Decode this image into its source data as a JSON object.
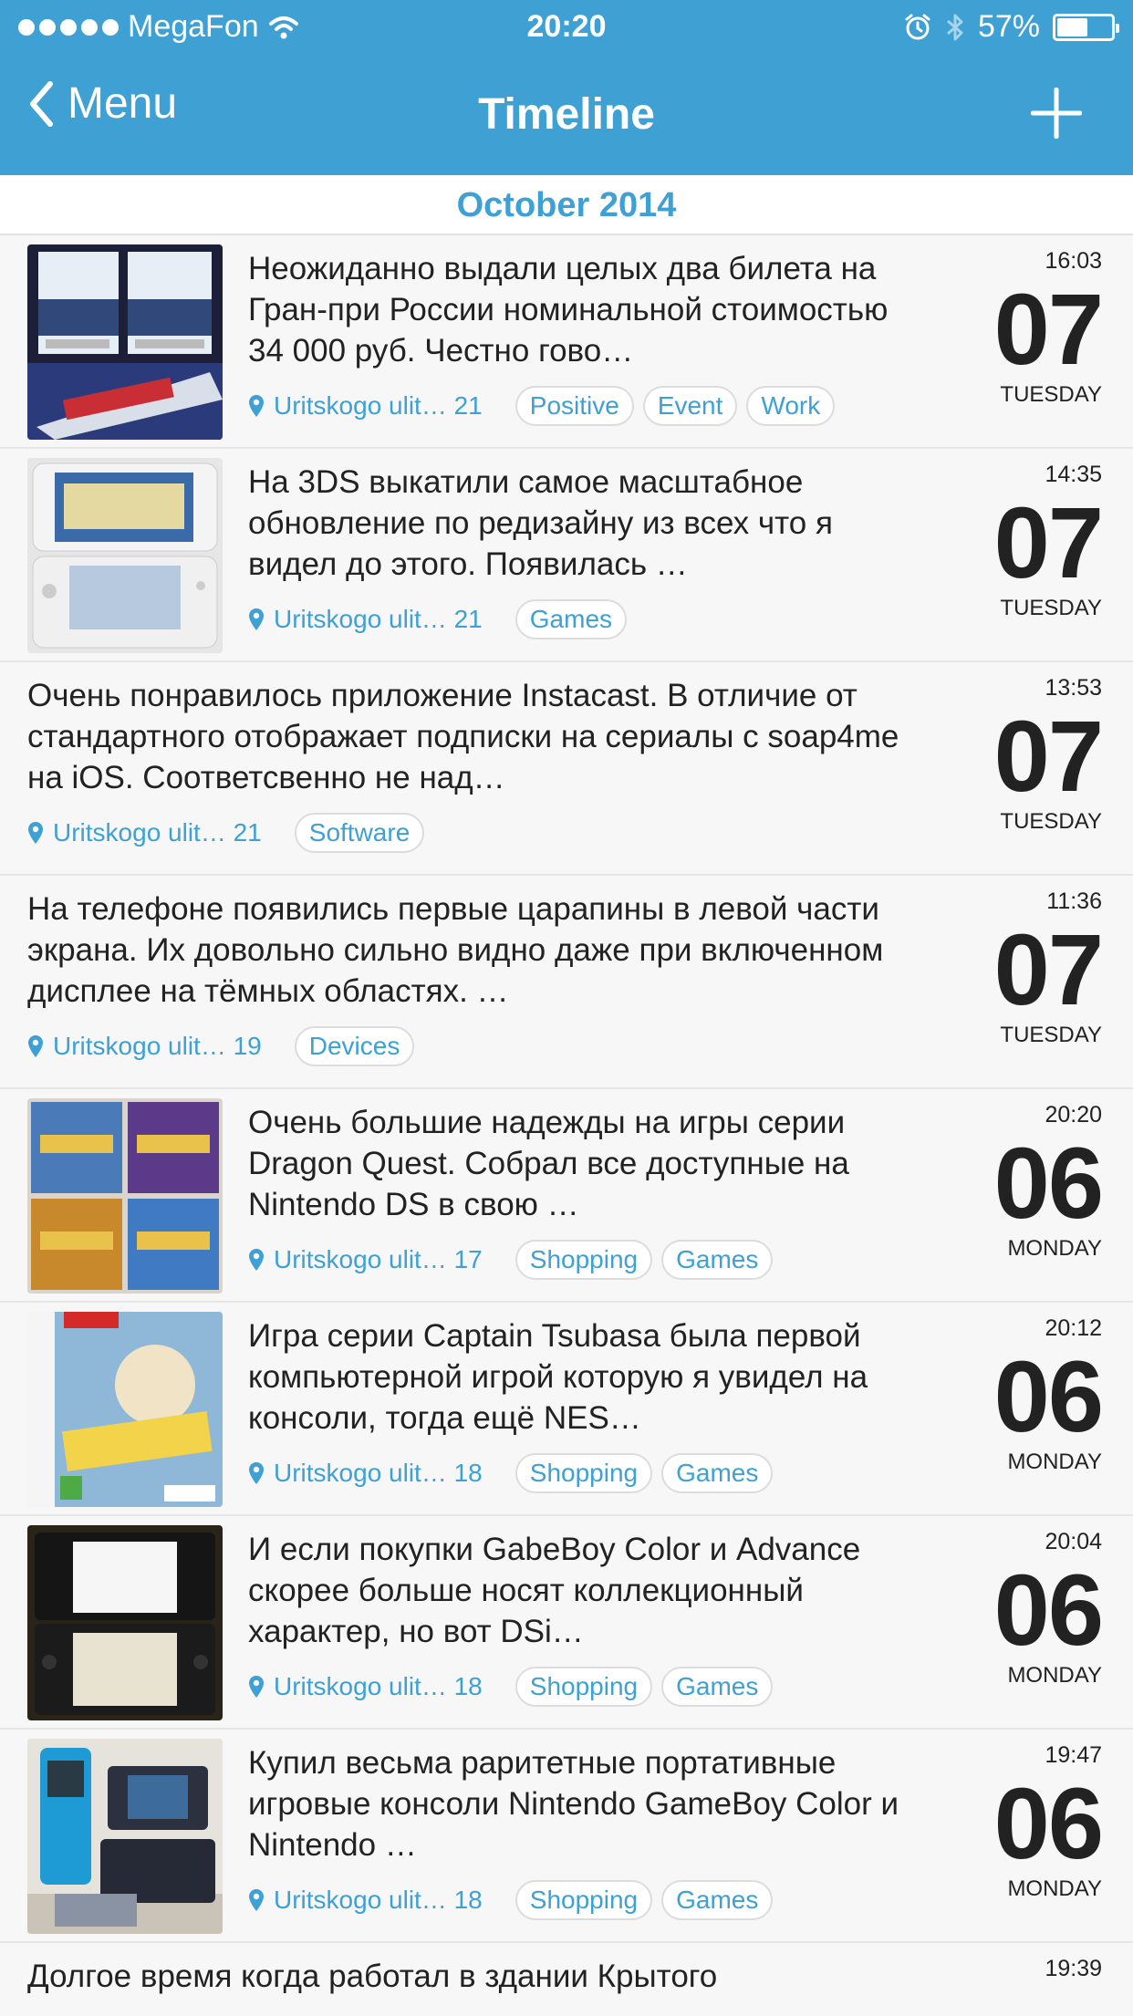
{
  "status": {
    "carrier": "MegaFon",
    "time": "20:20",
    "battery": "57%",
    "battery_level": 0.57
  },
  "nav": {
    "back_label": "Menu",
    "title": "Timeline"
  },
  "section": {
    "label": "October 2014"
  },
  "entries": [
    {
      "text": "Неожиданно выдали целых два билета на Гран-при России номинальной стоимостью 34 000 руб. Честно гово…",
      "location": "Uritskogo ulit… 21",
      "tags": [
        "Positive",
        "Event",
        "Work"
      ],
      "time": "16:03",
      "day": "07",
      "weekday": "TUESDAY",
      "thumb": "f1-tickets-photo"
    },
    {
      "text": "На 3DS выкатили самое масштабное обновление по редизайну из всех что я видел до этого. Появилась …",
      "location": "Uritskogo ulit… 21",
      "tags": [
        "Games"
      ],
      "time": "14:35",
      "day": "07",
      "weekday": "TUESDAY",
      "thumb": "3ds-console-photo"
    },
    {
      "text": "Очень понравилось приложение Instacast. В отличие от стандартного отображает подписки на сериалы с soap4me на iOS. Соответсвенно не над…",
      "location": "Uritskogo ulit… 21",
      "tags": [
        "Software"
      ],
      "time": "13:53",
      "day": "07",
      "weekday": "TUESDAY"
    },
    {
      "text": "На телефоне появились первые царапины в левой части экрана. Их довольно сильно видно даже при включенном дисплее на тёмных областях. …",
      "location": "Uritskogo ulit… 19",
      "tags": [
        "Devices"
      ],
      "time": "11:36",
      "day": "07",
      "weekday": "TUESDAY"
    },
    {
      "text": "Очень большие надежды на игры серии Dragon Quest. Собрал все доступные на Nintendo DS в свою …",
      "location": "Uritskogo ulit… 17",
      "tags": [
        "Shopping",
        "Games"
      ],
      "time": "20:20",
      "day": "06",
      "weekday": "MONDAY",
      "thumb": "dragon-quest-boxes-photo"
    },
    {
      "text": "Игра серии Captain Tsubasa была первой компьютерной игрой которую я увидел на консоли, тогда ещё NES…",
      "location": "Uritskogo ulit… 18",
      "tags": [
        "Shopping",
        "Games"
      ],
      "time": "20:12",
      "day": "06",
      "weekday": "MONDAY",
      "thumb": "captain-tsubasa-box-photo"
    },
    {
      "text": "И если покупки GabeBoy Color и Advance скорее больше носят коллекционный характер, но вот DSi…",
      "location": "Uritskogo ulit… 18",
      "tags": [
        "Shopping",
        "Games"
      ],
      "time": "20:04",
      "day": "06",
      "weekday": "MONDAY",
      "thumb": "dsi-console-photo"
    },
    {
      "text": "Купил весьма раритетные портативные игровые консоли Nintendo GameBoy Color и Nintendo …",
      "location": "Uritskogo ulit… 18",
      "tags": [
        "Shopping",
        "Games"
      ],
      "time": "19:47",
      "day": "06",
      "weekday": "MONDAY",
      "thumb": "gameboy-consoles-photo"
    }
  ],
  "partial_entry": {
    "text": "Долгое время когда работал в здании Крытого",
    "time": "19:39"
  },
  "colors": {
    "accent": "#3ea0d3",
    "background": "#f7f7f7"
  }
}
